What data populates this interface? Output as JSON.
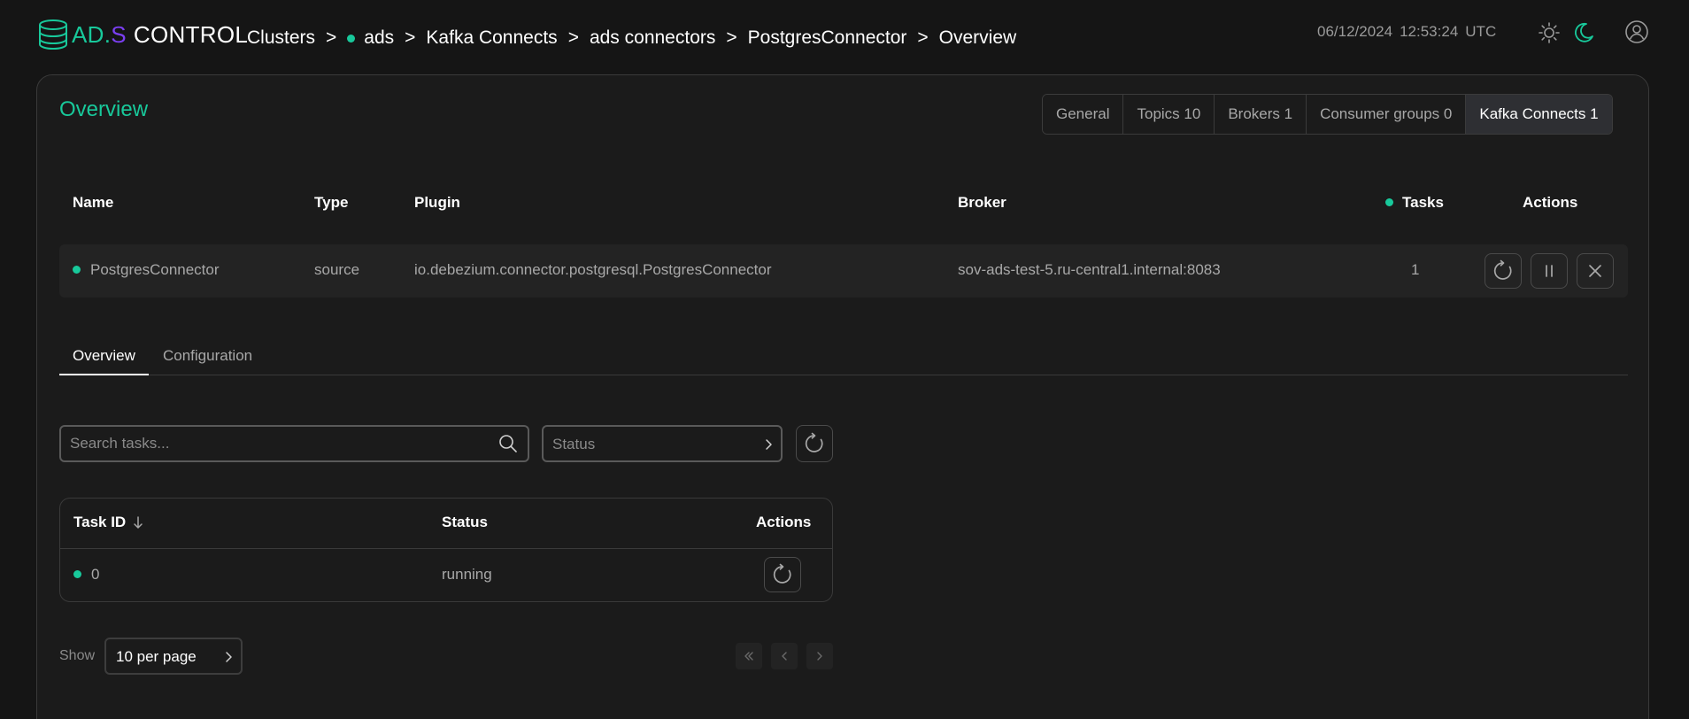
{
  "logo": {
    "ad": "AD.",
    "s": "S",
    "control": "CONTROL"
  },
  "breadcrumb": {
    "items": [
      "Clusters",
      "ads",
      "Kafka Connects",
      "ads connectors",
      "PostgresConnector",
      "Overview"
    ],
    "separator": ">"
  },
  "header": {
    "date": "06/12/2024",
    "time": "12:53:24",
    "timezone": "UTC"
  },
  "page": {
    "title": "Overview"
  },
  "seg_tabs": [
    "General",
    "Topics 10",
    "Brokers 1",
    "Consumer groups 0",
    "Kafka Connects 1"
  ],
  "connector_table": {
    "headers": {
      "name": "Name",
      "type": "Type",
      "plugin": "Plugin",
      "broker": "Broker",
      "tasks": "Tasks",
      "actions": "Actions"
    },
    "row": {
      "name": "PostgresConnector",
      "type": "source",
      "plugin": "io.debezium.connector.postgresql.PostgresConnector",
      "broker": "sov-ads-test-5.ru-central1.internal:8083",
      "tasks": "1"
    }
  },
  "sub_tabs": {
    "overview": "Overview",
    "configuration": "Configuration"
  },
  "filters": {
    "search_placeholder": "Search tasks...",
    "status_placeholder": "Status"
  },
  "tasks_table": {
    "headers": {
      "task_id": "Task ID",
      "status": "Status",
      "actions": "Actions"
    },
    "rows": [
      {
        "task_id": "0",
        "status": "running"
      }
    ]
  },
  "pagination": {
    "show_label": "Show",
    "per_page": "10 per page"
  },
  "colors": {
    "accent": "#18c99b",
    "brand_purple": "#7b3ff2",
    "background": "#151515",
    "panel": "#1b1b1b"
  }
}
